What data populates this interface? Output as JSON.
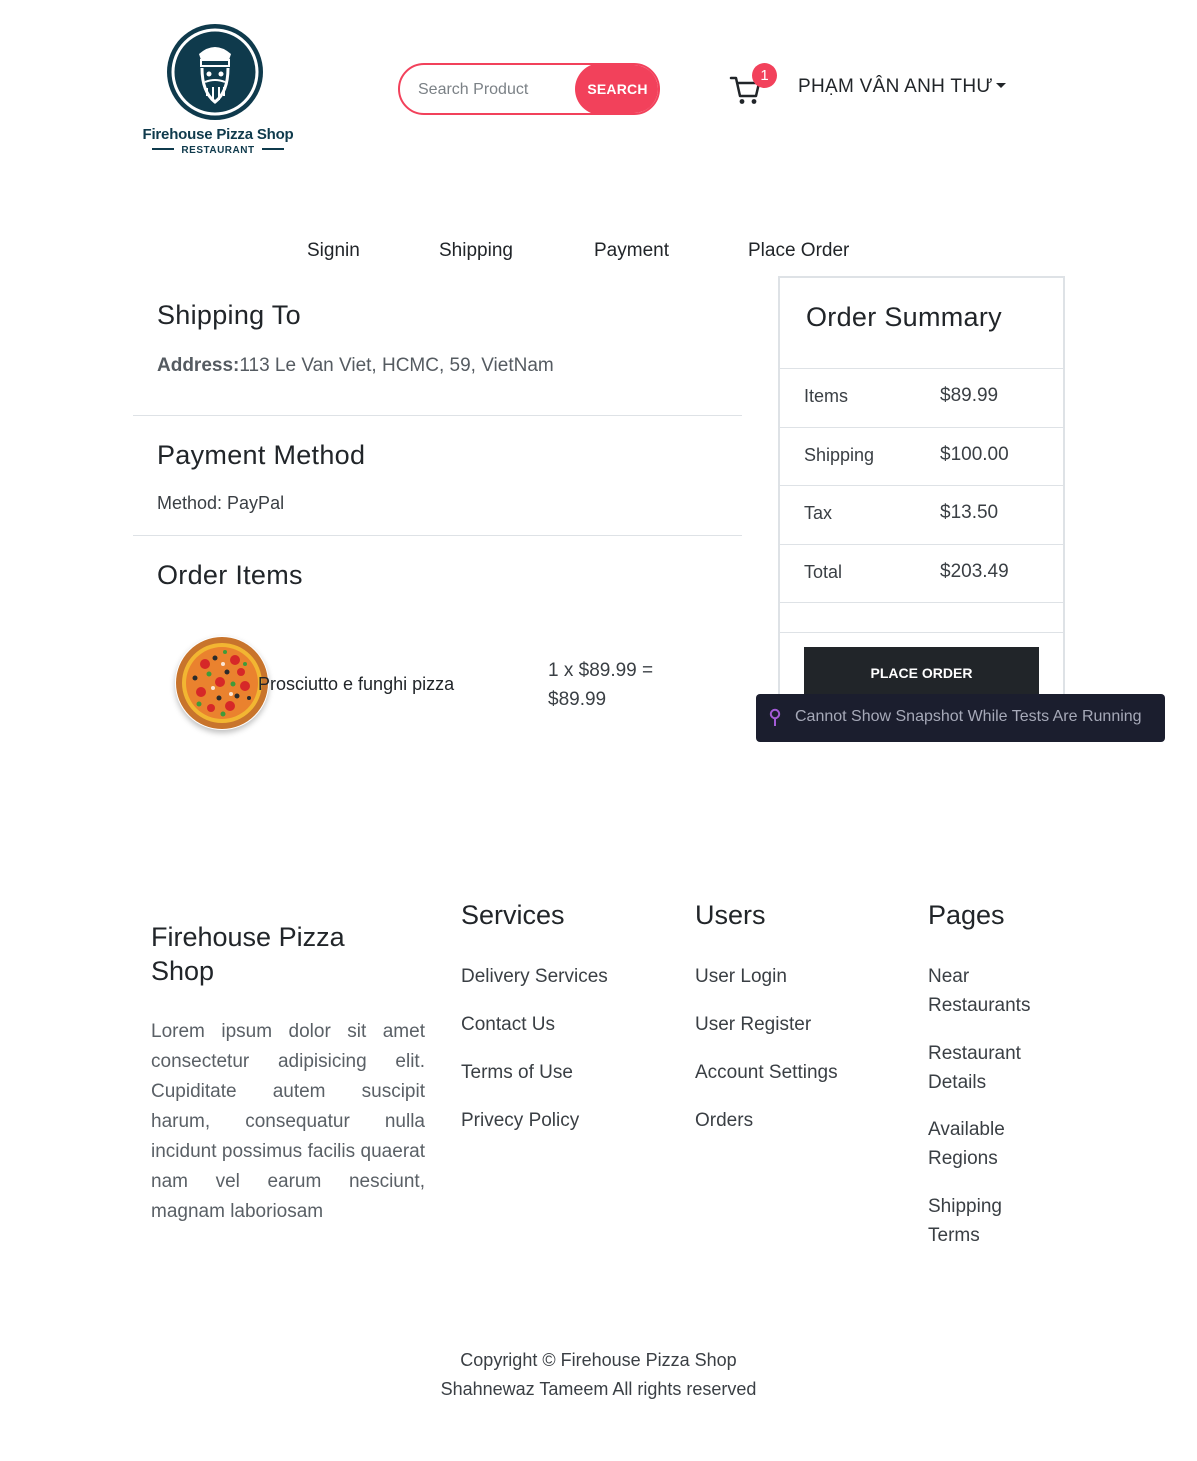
{
  "brand": {
    "logo_name": "Firehouse Pizza Shop",
    "logo_sub": "RESTAURANT",
    "colors": {
      "navy": "#0f3a4c",
      "accent": "#f2415b",
      "dark": "#212529"
    }
  },
  "search": {
    "placeholder": "Search Product",
    "button_label": "SEARCH"
  },
  "cart": {
    "icon": "cart-icon",
    "count": "1"
  },
  "user": {
    "name": "PHẠM VÂN ANH THƯ"
  },
  "steps": [
    "Signin",
    "Shipping",
    "Payment",
    "Place Order"
  ],
  "shipping": {
    "title": "Shipping To",
    "address_label": "Address:",
    "address_value": "113 Le Van Viet, HCMC, 59, VietNam"
  },
  "payment": {
    "title": "Payment Method",
    "method": "Method: PayPal"
  },
  "order_items": {
    "title": "Order Items",
    "items": [
      {
        "name": "Prosciutto e funghi pizza",
        "qty_price": "1 x $89.99 =",
        "subtotal": "$89.99",
        "image": "pizza-image"
      }
    ]
  },
  "summary": {
    "title": "Order Summary",
    "rows": [
      {
        "label": "Items",
        "value": "$89.99"
      },
      {
        "label": "Shipping",
        "value": "$100.00"
      },
      {
        "label": "Tax",
        "value": "$13.50"
      },
      {
        "label": "Total",
        "value": "$203.49"
      }
    ],
    "button_label": "PLACE ORDER"
  },
  "toast": {
    "text": "Cannot Show Snapshot While Tests Are Running",
    "icon": "pin-icon"
  },
  "footer": {
    "brand_title": "Firehouse Pizza Shop",
    "description": "Lorem ipsum dolor sit amet consectetur adipisicing elit. Cupiditate autem suscipit harum, consequatur nulla incidunt possimus facilis quaerat nam vel earum nesciunt, magnam laboriosam",
    "services": {
      "title": "Services",
      "links": [
        "Delivery Services",
        "Contact Us",
        "Terms of Use",
        "Privecy Policy"
      ]
    },
    "users": {
      "title": "Users",
      "links": [
        "User Login",
        "User Register",
        "Account Settings",
        "Orders"
      ]
    },
    "pages": {
      "title": "Pages",
      "links": [
        "Near Restaurants",
        "Restaurant Details",
        "Available Regions",
        "Shipping Terms"
      ]
    },
    "copyright_line1": "Copyright © Firehouse Pizza Shop",
    "copyright_line2": "Shahnewaz Tameem All rights reserved"
  }
}
